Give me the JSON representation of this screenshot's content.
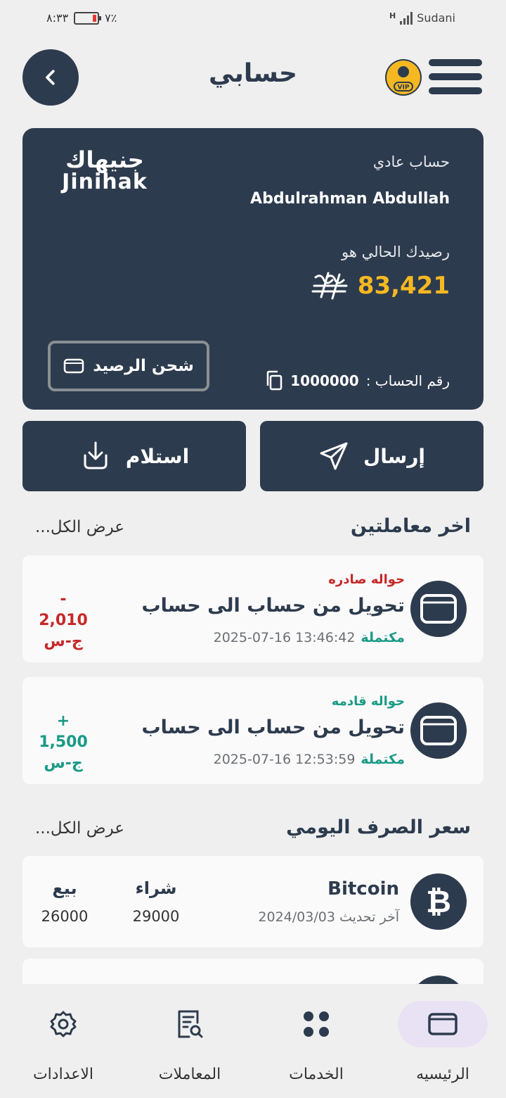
{
  "status_bar": {
    "time": "٨:٣٣",
    "battery": "٧٪",
    "network_icon": "H",
    "carrier": "Sudani"
  },
  "header": {
    "title": "حسابي",
    "vip_badge": "VIP"
  },
  "card": {
    "logo_ar": "جنيهاك",
    "logo_en": "Jinihak",
    "account_type": "حساب عادي",
    "account_name": "Abdulrahman Abdullah",
    "balance_label": "رصيدك الحالي هو",
    "balance": "83,421",
    "account_number_label": "رقم الحساب :",
    "account_number": "1000000",
    "topup_label": "شحن الرصيد"
  },
  "actions": {
    "send": "إرسال",
    "receive": "استلام"
  },
  "transactions": {
    "title": "اخر معاملتين",
    "view_all": "عرض الكل...",
    "items": [
      {
        "direction": "حواله صادره",
        "description": "تحويل من حساب الى حساب",
        "date": "2025-07-16 13:46:42",
        "status": "مكتملة",
        "amount": "- 2,010",
        "currency": "ج-س"
      },
      {
        "direction": "حواله قادمه",
        "description": "تحويل من حساب الى حساب",
        "date": "2025-07-16 12:53:59",
        "status": "مكتملة",
        "amount": "+ 1,500",
        "currency": "ج-س"
      }
    ]
  },
  "exchange": {
    "title": "سعر الصرف اليومي",
    "view_all": "عرض الكل...",
    "items": [
      {
        "name": "Bitcoin",
        "updated": "آخر تحديث 2024/03/03",
        "buy_label": "شراء",
        "buy": "29000",
        "sell_label": "بيع",
        "sell": "26000"
      }
    ]
  },
  "nav": {
    "home": "الرئيسيه",
    "services": "الخدمات",
    "transactions": "المعاملات",
    "settings": "الاعدادات"
  },
  "colors": {
    "primary": "#2d3b4e",
    "accent": "#f5b821",
    "outgoing": "#c62828",
    "incoming": "#1a9a86",
    "nav_active": "#e8e2f4"
  }
}
